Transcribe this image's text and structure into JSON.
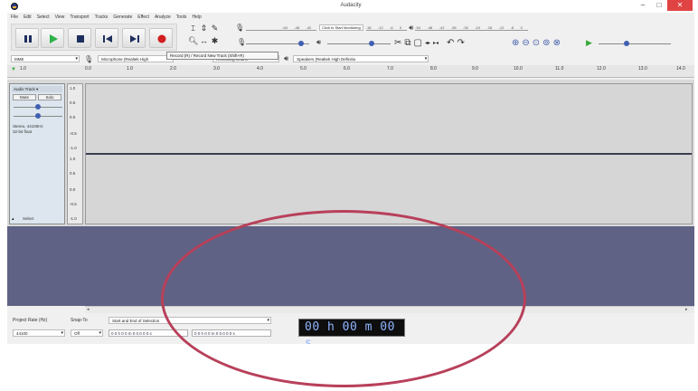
{
  "window": {
    "title": "Audacity",
    "min": "–",
    "max": "□",
    "close": "✕"
  },
  "menu": [
    "File",
    "Edit",
    "Select",
    "View",
    "Transport",
    "Tracks",
    "Generate",
    "Effect",
    "Analyze",
    "Tools",
    "Help"
  ],
  "meters": {
    "record_scale": [
      "-54",
      "-48",
      "-42"
    ],
    "record_click": "Click to Start Monitoring",
    "record_scale2": [
      "-18",
      "-12",
      "-6",
      "0"
    ],
    "play_scale": [
      "-54",
      "-48",
      "-42",
      "-36",
      "-30",
      "-24",
      "-18",
      "-12",
      "-6",
      "0"
    ]
  },
  "device": {
    "host": "MME",
    "mic": "Microphone (Realtek High",
    "channels": "Recording Chann",
    "speaker": "Speakers (Realtek High Definitio"
  },
  "tooltip": "Record (R) / Record New Track (Shift+R)",
  "ruler": {
    "filter_label": "1.0",
    "ticks": [
      "0.0",
      "1.0",
      "2.0",
      "3.0",
      "4.0",
      "5.0",
      "6.0",
      "7.0",
      "8.0",
      "9.0",
      "10.0",
      "11.0",
      "12.0",
      "13.0",
      "14.0"
    ]
  },
  "track": {
    "name": "Audio Track",
    "mute": "Mute",
    "solo": "Solo",
    "info": [
      "Stereo, 44100Hz",
      "32-bit float"
    ],
    "select": "Select",
    "vruler": [
      "1.0",
      "0.5",
      "0.0",
      "-0.5",
      "-1.0",
      "1.0",
      "0.5",
      "0.0",
      "-0.5",
      "-1.0"
    ]
  },
  "selection": {
    "project_rate_label": "Project Rate (Hz)",
    "snap_label": "Snap-To",
    "start_end_label": "Start and End of Selection",
    "rate_value": "44100",
    "snap_value": "Off",
    "start_time": "0 0 h 0 0 m 0 0.0 0 0 s",
    "end_time": "0 0 h 0 0 m 0 0.0 0 0 s",
    "big_time": "00 h 00 m 00 s"
  }
}
